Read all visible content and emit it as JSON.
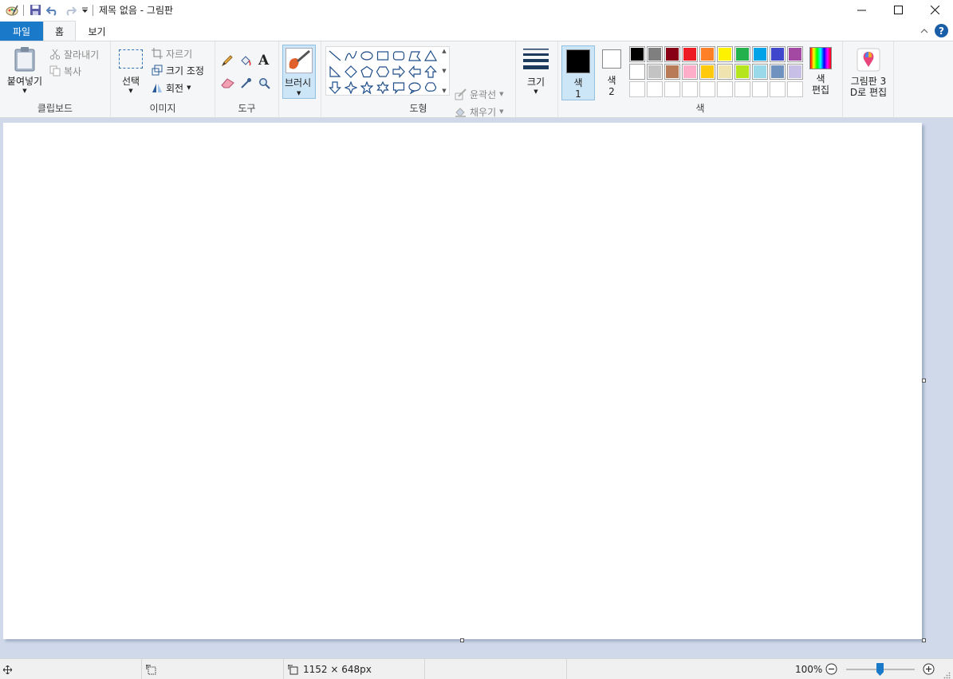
{
  "window": {
    "title": "제목 없음 - 그림판",
    "icons": [
      "paint-app-icon",
      "save-icon",
      "undo-icon",
      "redo-icon",
      "customize-dropdown-icon",
      "minimize-icon",
      "maximize-icon",
      "close-icon"
    ]
  },
  "tabs": [
    {
      "label": "파일"
    },
    {
      "label": "홈"
    },
    {
      "label": "보기"
    }
  ],
  "ribbon": {
    "clipboard": {
      "group_label": "클립보드",
      "paste": "붙여넣기",
      "cut": "잘라내기",
      "copy": "복사"
    },
    "image": {
      "group_label": "이미지",
      "select": "선택",
      "crop": "자르기",
      "resize": "크기 조정",
      "rotate": "회전"
    },
    "tools": {
      "group_label": "도구",
      "items": [
        "pencil-icon",
        "fill-icon",
        "text-icon",
        "eraser-icon",
        "color-picker-icon",
        "magnifier-icon"
      ]
    },
    "brushes": {
      "label": "브러시"
    },
    "shapes": {
      "group_label": "도형",
      "outline": "윤곽선",
      "fill": "채우기"
    },
    "size": {
      "label": "크기"
    },
    "colors": {
      "group_label": "색",
      "color1_label_line1": "색",
      "color1_label_line2": "1",
      "color2_label_line1": "색",
      "color2_label_line2": "2",
      "color1_value": "#000000",
      "color2_value": "#ffffff",
      "edit_colors_line1": "색",
      "edit_colors_line2": "편집",
      "paint3d_line1": "그림판 3",
      "paint3d_line2": "D로 편집",
      "palette_row1": [
        "#000000",
        "#7f7f7f",
        "#880015",
        "#ed1c24",
        "#ff7f27",
        "#fff200",
        "#22b14c",
        "#00a2e8",
        "#3f48cc",
        "#a349a4"
      ],
      "palette_row2": [
        "#ffffff",
        "#c3c3c3",
        "#b97a57",
        "#ffaec9",
        "#ffc90e",
        "#efe4b0",
        "#b5e61d",
        "#99d9ea",
        "#7092be",
        "#c8bfe7"
      ]
    }
  },
  "statusbar": {
    "canvas_size": "1152 × 648px",
    "zoom": "100%",
    "zoom_level_percent": 100
  },
  "accent": "#1a79c9"
}
